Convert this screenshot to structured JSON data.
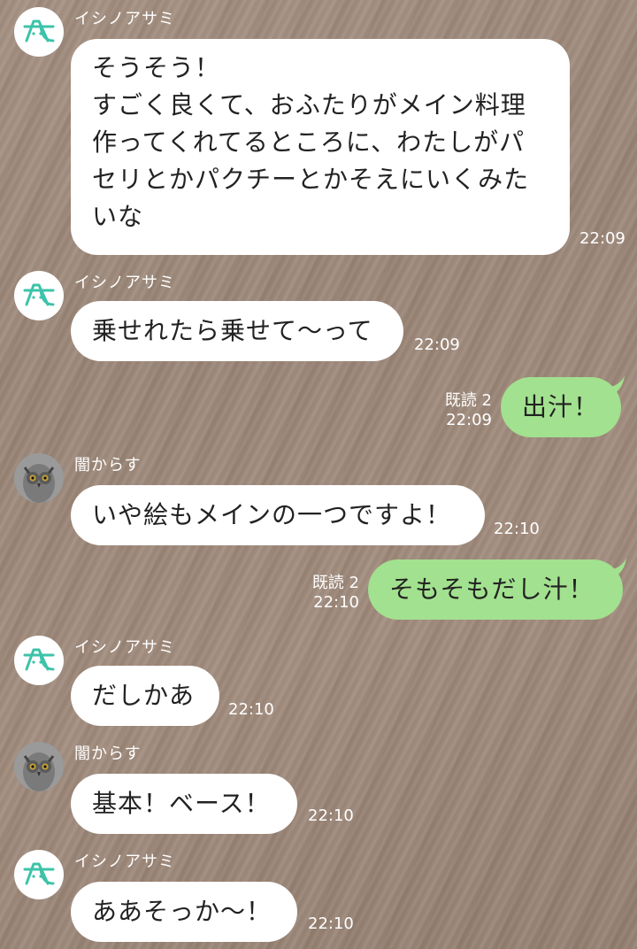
{
  "colors": {
    "bubble_in": "#ffffff",
    "bubble_out": "#a2e18f",
    "meta_text": "#ffffff"
  },
  "messages": [
    {
      "sender": "イシノアサミ",
      "avatar": "a-logo-icon",
      "text": "そうそう！\nすごく良くて、おふたりがメイン料理\n作ってくれてるところに、わたしがパ\nセリとかパクチーとかそえにいくみた\nいな",
      "time": "22:09"
    },
    {
      "sender": "イシノアサミ",
      "avatar": "a-logo-icon",
      "text": "乗せれたら乗せて〜って",
      "time": "22:09"
    },
    {
      "outgoing": true,
      "read": "既読 2",
      "time": "22:09",
      "text": "出汁！"
    },
    {
      "sender": "闇からす",
      "avatar": "owl-icon",
      "text": "いや絵もメインの一つですよ！",
      "time": "22:10"
    },
    {
      "outgoing": true,
      "read": "既読 2",
      "time": "22:10",
      "text": "そもそもだし汁！"
    },
    {
      "sender": "イシノアサミ",
      "avatar": "a-logo-icon",
      "text": "だしかあ",
      "time": "22:10"
    },
    {
      "sender": "闇からす",
      "avatar": "owl-icon",
      "text": "基本！ベース！",
      "time": "22:10"
    },
    {
      "sender": "イシノアサミ",
      "avatar": "a-logo-icon",
      "text": "ああそっか〜！",
      "time": "22:10"
    }
  ]
}
